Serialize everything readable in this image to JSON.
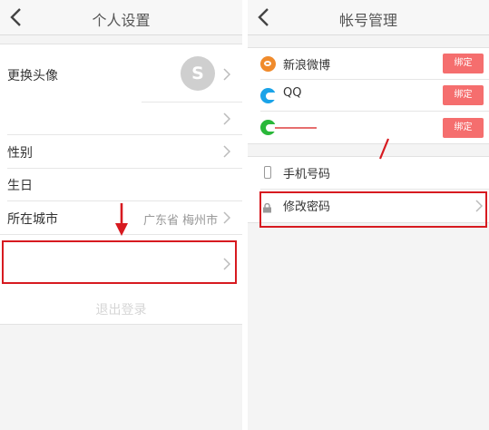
{
  "left_screen": {
    "title": "个人设置",
    "items": [
      {
        "label": "更换头像"
      },
      {
        "label": ""
      },
      {
        "label": "性别"
      },
      {
        "label": "生日"
      },
      {
        "label": "所在城市",
        "value": "广东省 梅州市"
      },
      {
        "label": ""
      }
    ],
    "avatar_glyph": "S",
    "footer_text": "退出登录"
  },
  "right_screen": {
    "title": "帐号管理",
    "social": [
      {
        "name": "新浪微博",
        "icon": "weibo-icon",
        "button": "绑定"
      },
      {
        "name": "QQ",
        "icon": "qq-icon",
        "button": "绑定"
      },
      {
        "name": "",
        "icon": "wechat-icon",
        "button": "绑定"
      }
    ],
    "settings": [
      {
        "label": "手机号码",
        "icon": "phone-icon"
      },
      {
        "label": "修改密码",
        "icon": "lock-icon"
      }
    ]
  },
  "colors": {
    "accent_red": "#d71a20",
    "bind_button": "#f56e6e",
    "weibo": "#f08b2c",
    "qq": "#1aa3e8",
    "wechat": "#2ab83a"
  }
}
